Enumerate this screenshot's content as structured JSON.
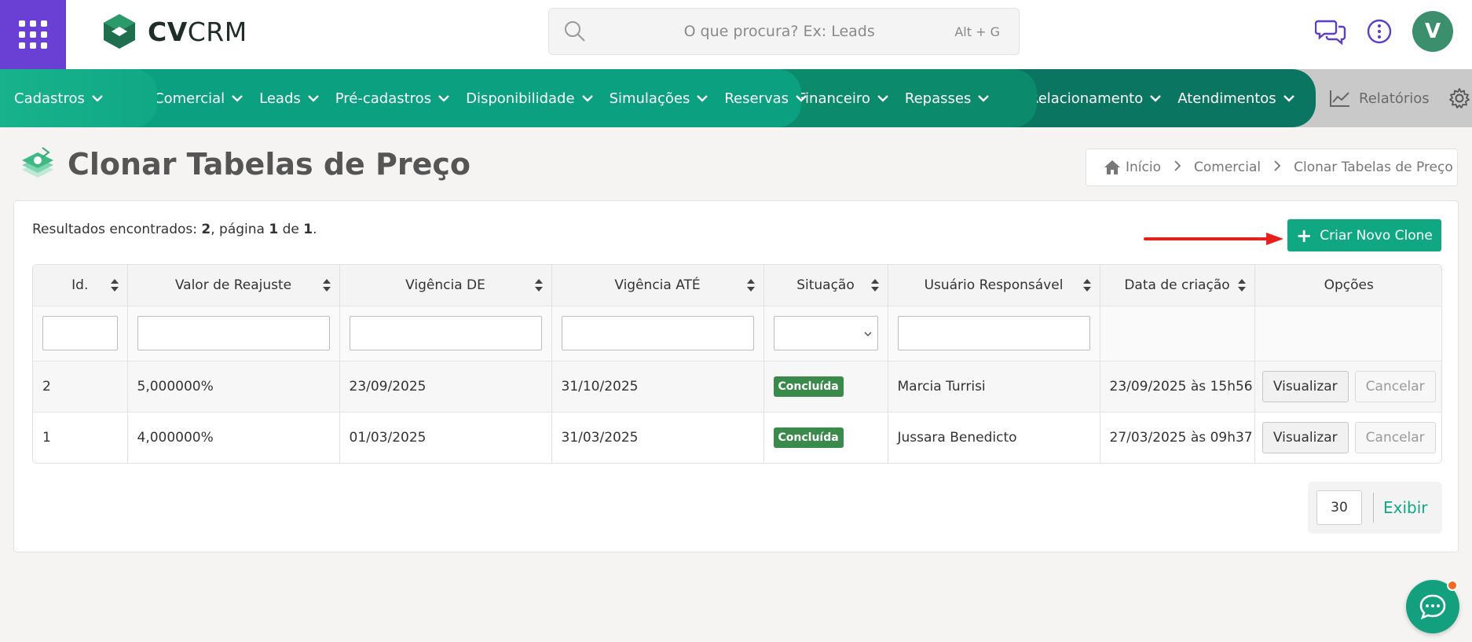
{
  "brand": {
    "name_bold": "CV",
    "name_rest": "CRM",
    "apps_icon": "apps-grid-icon"
  },
  "search": {
    "placeholder": "O que procura? Ex: Leads",
    "shortcut": "Alt + G"
  },
  "user": {
    "initial": "V"
  },
  "nav": {
    "groups": [
      [
        "Cadastros"
      ],
      [
        "Comercial",
        "Leads",
        "Pré-cadastros",
        "Disponibilidade",
        "Simulações",
        "Reservas"
      ],
      [
        "Financeiro",
        "Repasses"
      ],
      [
        "Relacionamento",
        "Atendimentos"
      ]
    ],
    "reports_label": "Relatórios"
  },
  "page": {
    "title": "Clonar Tabelas de Preço",
    "breadcrumb": [
      "Início",
      "Comercial",
      "Clonar Tabelas de Preço"
    ]
  },
  "results": {
    "prefix": "Resultados encontrados: ",
    "count": "2",
    "mid": ", página ",
    "page": "1",
    "of": " de ",
    "total": "1",
    "suffix": "."
  },
  "new_button": "Criar Novo Clone",
  "table": {
    "headers": [
      "Id.",
      "Valor de Reajuste",
      "Vigência DE",
      "Vigência ATÉ",
      "Situação",
      "Usuário Responsável",
      "Data de criação",
      "Opções"
    ],
    "rows": [
      {
        "id": "2",
        "valor": "5,000000%",
        "de": "23/09/2025",
        "ate": "31/10/2025",
        "situacao": "Concluída",
        "usuario": "Marcia Turrisi",
        "criacao": "23/09/2025 às 15h56",
        "view": "Visualizar",
        "cancel": "Cancelar"
      },
      {
        "id": "1",
        "valor": "4,000000%",
        "de": "01/03/2025",
        "ate": "31/03/2025",
        "situacao": "Concluída",
        "usuario": "Jussara Benedicto",
        "criacao": "27/03/2025 às 09h37",
        "view": "Visualizar",
        "cancel": "Cancelar"
      }
    ]
  },
  "pager": {
    "per_page": "30",
    "button": "Exibir"
  },
  "colors": {
    "accent": "#0fa883",
    "purple": "#6a3fd3",
    "badge": "#3a8a4b",
    "notification": "#f26a21"
  }
}
